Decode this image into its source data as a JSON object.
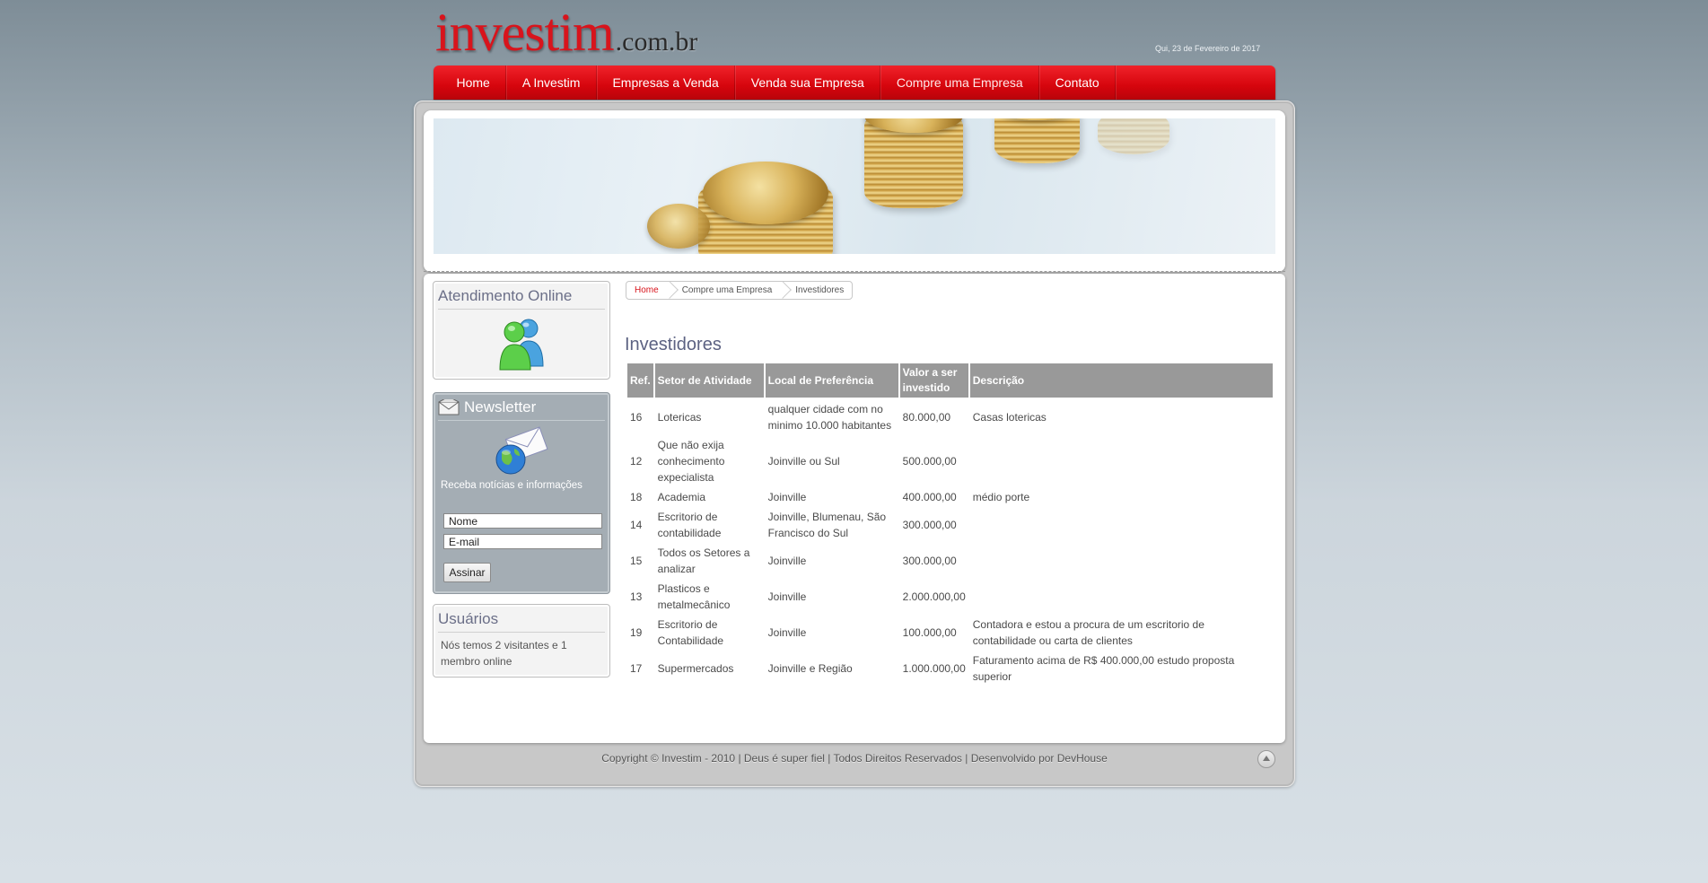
{
  "header": {
    "logo_main": "investim",
    "logo_suffix": ".com.br",
    "date": "Qui, 23 de Fevereiro de 2017"
  },
  "menu": {
    "items": [
      {
        "label": "Home"
      },
      {
        "label": "A Investim"
      },
      {
        "label": "Empresas a Venda"
      },
      {
        "label": "Venda sua Empresa"
      },
      {
        "label": "Compre uma Empresa",
        "active": true
      },
      {
        "label": "Contato"
      }
    ]
  },
  "sidebar": {
    "online": {
      "title": "Atendimento Online",
      "icon": "msn-users-icon"
    },
    "newsletter": {
      "title": "Newsletter",
      "icon": "envelope-icon",
      "text": "Receba notícias e informações",
      "name_value": "Nome",
      "email_value": "E-mail",
      "submit_label": "Assinar"
    },
    "users": {
      "title": "Usuários",
      "text": "Nós temos 2 visitantes e 1 membro online"
    }
  },
  "breadcrumb": {
    "home": "Home",
    "section": "Compre uma Empresa",
    "current": "Investidores"
  },
  "page": {
    "title": "Investidores"
  },
  "table": {
    "headers": [
      "Ref.",
      "Setor de Atividade",
      "Local de Preferência",
      "Valor a ser investido",
      "Descrição"
    ],
    "rows": [
      [
        "16",
        "Lotericas",
        "qualquer cidade com no minimo 10.000 habitantes",
        "80.000,00",
        "Casas lotericas"
      ],
      [
        "12",
        "Que não exija conhecimento expecialista",
        "Joinville ou Sul",
        "500.000,00",
        ""
      ],
      [
        "18",
        "Academia",
        "Joinville",
        "400.000,00",
        "médio porte"
      ],
      [
        "14",
        "Escritorio de contabilidade",
        "Joinville, Blumenau, São Francisco do Sul",
        "300.000,00",
        ""
      ],
      [
        "15",
        "Todos os Setores a analizar",
        "Joinville",
        "300.000,00",
        ""
      ],
      [
        "13",
        "Plasticos e metalmecânico",
        "Joinville",
        "2.000.000,00",
        ""
      ],
      [
        "19",
        "Escritorio de Contabilidade",
        "Joinville",
        "100.000,00",
        "Contadora e estou a procura de um escritorio de contabilidade ou carta de clientes"
      ],
      [
        "17",
        "Supermercados",
        "Joinville e Região",
        "1.000.000,00",
        "Faturamento acima de R$ 400.000,00 estudo proposta superior"
      ]
    ]
  },
  "footer": {
    "text": "Copyright © Investim - 2010 | Deus é super fiel | Todos Direitos Reservados | Desenvolvido por DevHouse",
    "top_icon": "back-to-top-icon"
  },
  "colors": {
    "brand_red": "#d8141c",
    "table_header": "#999999",
    "title_blue": "#5c6282"
  }
}
